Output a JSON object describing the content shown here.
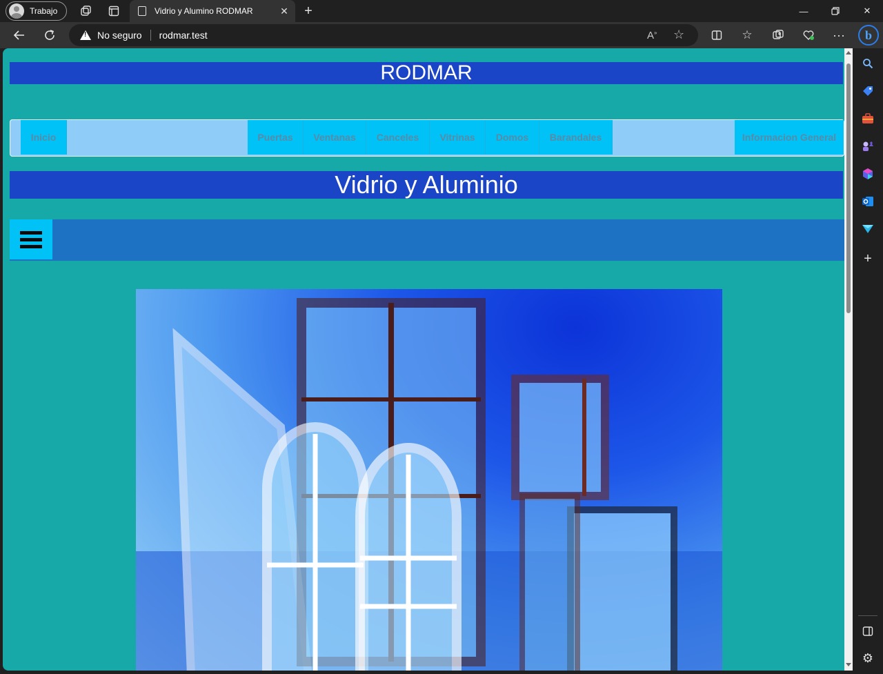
{
  "browser": {
    "profile_label": "Trabajo",
    "tab_title": "Vidrio y Alumino RODMAR",
    "security_label": "No seguro",
    "url": "rodmar.test"
  },
  "site": {
    "header_title": "RODMAR",
    "subtitle": "Vidrio y Aluminio",
    "menu": {
      "home": "Inicio",
      "doors": "Puertas",
      "windows": "Ventanas",
      "screens": "Canceles",
      "showcases": "Vitrinas",
      "domes": "Domos",
      "railings": "Barandales",
      "general_info": "Informacion General"
    },
    "hero_image": "windows-and-doors-photo"
  },
  "colors": {
    "page_bg": "#16a9a7",
    "header_bg": "#1a45c7",
    "menu_bar_bg": "#8fcdf8",
    "menu_item_bg": "#00c2f6",
    "hamburger_bar_bg": "#1e72c4"
  }
}
